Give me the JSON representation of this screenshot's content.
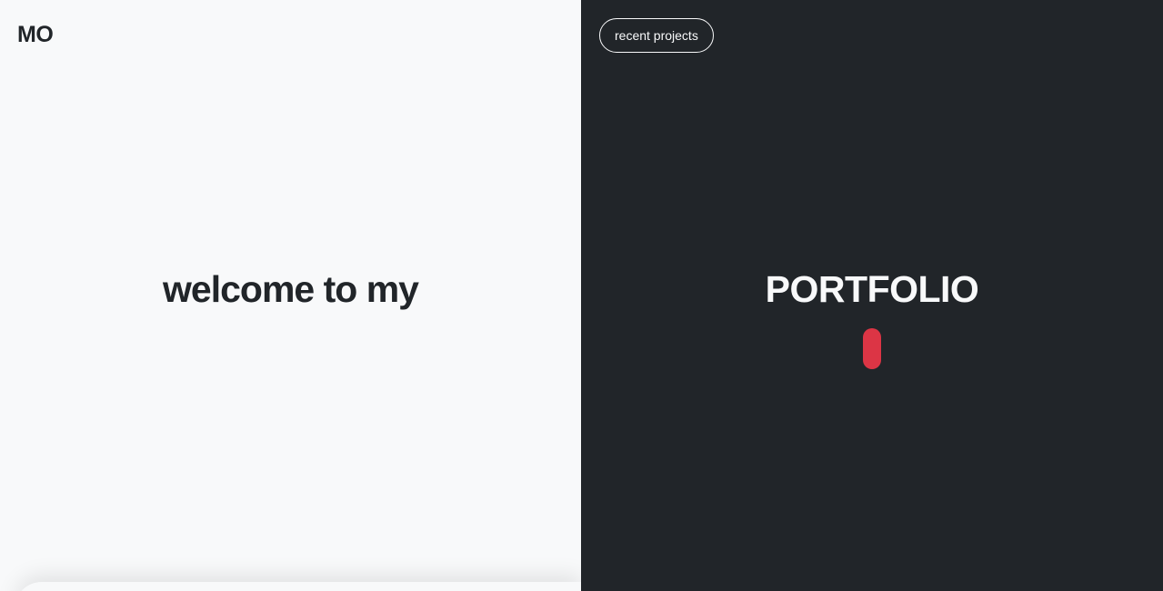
{
  "header": {
    "logo_text": "MO"
  },
  "hero": {
    "left_text": "welcome to my",
    "right_text": "PORTFOLIO"
  },
  "nav": {
    "recent_projects_label": "recent projects"
  },
  "colors": {
    "light_bg": "#f8f9fa",
    "dark_bg": "#212529",
    "accent": "#dc3545"
  }
}
